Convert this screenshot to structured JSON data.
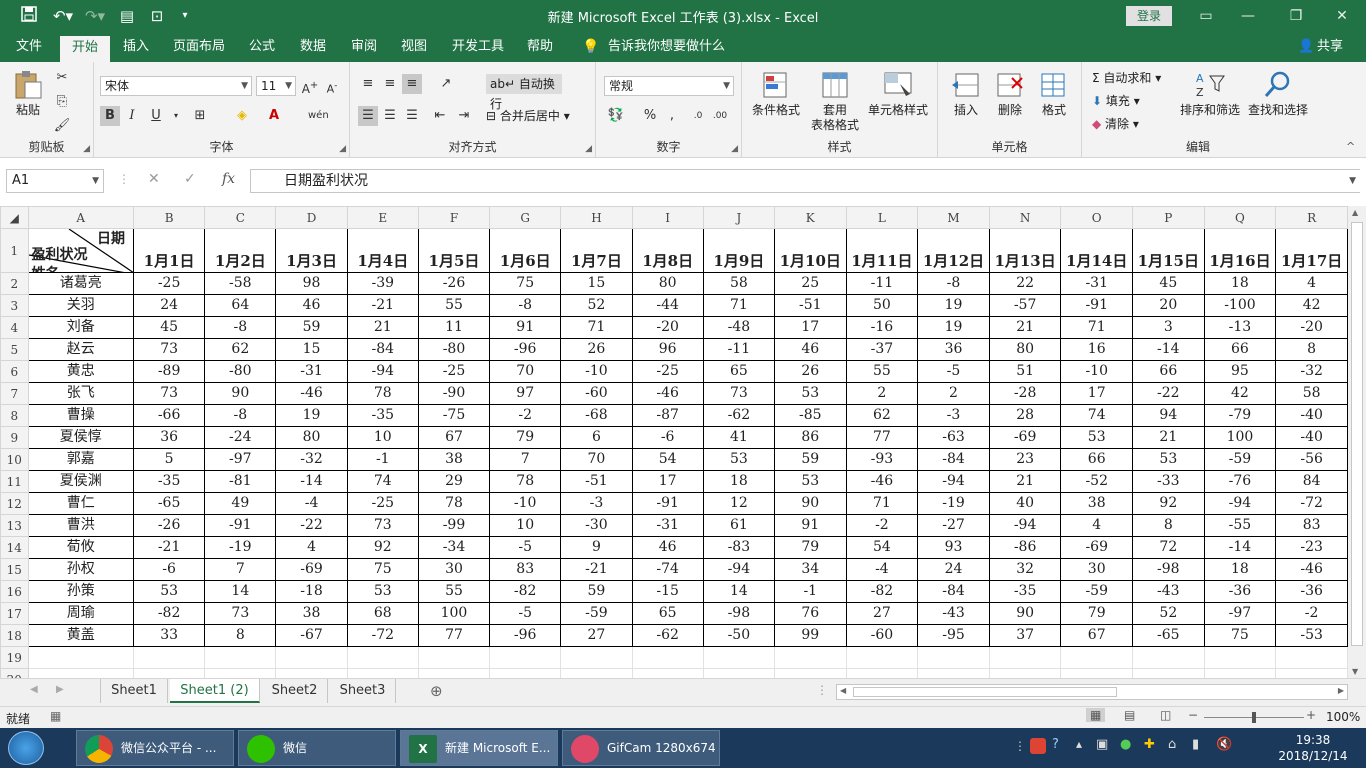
{
  "titlebar": {
    "title": "新建 Microsoft Excel 工作表 (3).xlsx  -  Excel",
    "login": "登录",
    "save_icon": "save-icon",
    "undo_icon": "undo-icon"
  },
  "tabs": [
    "文件",
    "开始",
    "插入",
    "页面布局",
    "公式",
    "数据",
    "审阅",
    "视图",
    "开发工具",
    "帮助"
  ],
  "tell_me": "告诉我你想要做什么",
  "share": "共享",
  "ribbon": {
    "clipboard": {
      "paste": "粘贴",
      "label": "剪贴板"
    },
    "font": {
      "name": "宋体",
      "size": "11",
      "label": "字体"
    },
    "align": {
      "wrap": "自动换行",
      "merge": "合并后居中",
      "label": "对齐方式"
    },
    "number": {
      "format": "常规",
      "label": "数字"
    },
    "styles": {
      "cond": "条件格式",
      "table1": "套用",
      "table2": "表格格式",
      "cell": "单元格样式",
      "label": "样式"
    },
    "cells": {
      "insert": "插入",
      "delete": "删除",
      "format": "格式",
      "label": "单元格"
    },
    "edit": {
      "autosum": "自动求和",
      "fill": "填充",
      "clear": "清除",
      "sort": "排序和筛选",
      "find": "查找和选择",
      "label": "编辑"
    }
  },
  "formula": {
    "cell": "A1",
    "content": "日期盈利状况",
    "fx": "fx"
  },
  "sheet": {
    "columns": [
      "A",
      "B",
      "C",
      "D",
      "E",
      "F",
      "G",
      "H",
      "I",
      "J",
      "K",
      "L",
      "M",
      "N",
      "O",
      "P",
      "Q",
      "R"
    ],
    "diag": {
      "top": "日期",
      "mid": "盈利状况",
      "bottom": "姓名"
    },
    "dates": [
      "1月1日",
      "1月2日",
      "1月3日",
      "1月4日",
      "1月5日",
      "1月6日",
      "1月7日",
      "1月8日",
      "1月9日",
      "1月10日",
      "1月11日",
      "1月12日",
      "1月13日",
      "1月14日",
      "1月15日",
      "1月16日",
      "1月17日"
    ],
    "rows": [
      {
        "name": "诸葛亮",
        "v": [
          "-25",
          "-58",
          "98",
          "-39",
          "-26",
          "75",
          "15",
          "80",
          "58",
          "25",
          "-11",
          "-8",
          "22",
          "-31",
          "45",
          "18",
          "4"
        ]
      },
      {
        "name": "关羽",
        "v": [
          "24",
          "64",
          "46",
          "-21",
          "55",
          "-8",
          "52",
          "-44",
          "71",
          "-51",
          "50",
          "19",
          "-57",
          "-91",
          "20",
          "-100",
          "42"
        ]
      },
      {
        "name": "刘备",
        "v": [
          "45",
          "-8",
          "59",
          "21",
          "11",
          "91",
          "71",
          "-20",
          "-48",
          "17",
          "-16",
          "19",
          "21",
          "71",
          "3",
          "-13",
          "-20"
        ]
      },
      {
        "name": "赵云",
        "v": [
          "73",
          "62",
          "15",
          "-84",
          "-80",
          "-96",
          "26",
          "96",
          "-11",
          "46",
          "-37",
          "36",
          "80",
          "16",
          "-14",
          "66",
          "8"
        ]
      },
      {
        "name": "黄忠",
        "v": [
          "-89",
          "-80",
          "-31",
          "-94",
          "-25",
          "70",
          "-10",
          "-25",
          "65",
          "26",
          "55",
          "-5",
          "51",
          "-10",
          "66",
          "95",
          "-32"
        ]
      },
      {
        "name": "张飞",
        "v": [
          "73",
          "90",
          "-46",
          "78",
          "-90",
          "97",
          "-60",
          "-46",
          "73",
          "53",
          "2",
          "2",
          "-28",
          "17",
          "-22",
          "42",
          "58"
        ]
      },
      {
        "name": "曹操",
        "v": [
          "-66",
          "-8",
          "19",
          "-35",
          "-75",
          "-2",
          "-68",
          "-87",
          "-62",
          "-85",
          "62",
          "-3",
          "28",
          "74",
          "94",
          "-79",
          "-40"
        ]
      },
      {
        "name": "夏侯惇",
        "v": [
          "36",
          "-24",
          "80",
          "10",
          "67",
          "79",
          "6",
          "-6",
          "41",
          "86",
          "77",
          "-63",
          "-69",
          "53",
          "21",
          "100",
          "-40"
        ]
      },
      {
        "name": "郭嘉",
        "v": [
          "5",
          "-97",
          "-32",
          "-1",
          "38",
          "7",
          "70",
          "54",
          "53",
          "59",
          "-93",
          "-84",
          "23",
          "66",
          "53",
          "-59",
          "-56"
        ]
      },
      {
        "name": "夏侯渊",
        "v": [
          "-35",
          "-81",
          "-14",
          "74",
          "29",
          "78",
          "-51",
          "17",
          "18",
          "53",
          "-46",
          "-94",
          "21",
          "-52",
          "-33",
          "-76",
          "84"
        ]
      },
      {
        "name": "曹仁",
        "v": [
          "-65",
          "49",
          "-4",
          "-25",
          "78",
          "-10",
          "-3",
          "-91",
          "12",
          "90",
          "71",
          "-19",
          "40",
          "38",
          "92",
          "-94",
          "-72"
        ]
      },
      {
        "name": "曹洪",
        "v": [
          "-26",
          "-91",
          "-22",
          "73",
          "-99",
          "10",
          "-30",
          "-31",
          "61",
          "91",
          "-2",
          "-27",
          "-94",
          "4",
          "8",
          "-55",
          "83"
        ]
      },
      {
        "name": "荀攸",
        "v": [
          "-21",
          "-19",
          "4",
          "92",
          "-34",
          "-5",
          "9",
          "46",
          "-83",
          "79",
          "54",
          "93",
          "-86",
          "-69",
          "72",
          "-14",
          "-23"
        ]
      },
      {
        "name": "孙权",
        "v": [
          "-6",
          "7",
          "-69",
          "75",
          "30",
          "83",
          "-21",
          "-74",
          "-94",
          "34",
          "-4",
          "24",
          "32",
          "30",
          "-98",
          "18",
          "-46"
        ]
      },
      {
        "name": "孙策",
        "v": [
          "53",
          "14",
          "-18",
          "53",
          "55",
          "-82",
          "59",
          "-15",
          "14",
          "-1",
          "-82",
          "-84",
          "-35",
          "-59",
          "-43",
          "-36",
          "-36"
        ]
      },
      {
        "name": "周瑜",
        "v": [
          "-82",
          "73",
          "38",
          "68",
          "100",
          "-5",
          "-59",
          "65",
          "-98",
          "76",
          "27",
          "-43",
          "90",
          "79",
          "52",
          "-97",
          "-2"
        ]
      },
      {
        "name": "黄盖",
        "v": [
          "33",
          "8",
          "-67",
          "-72",
          "77",
          "-96",
          "27",
          "-62",
          "-50",
          "99",
          "-60",
          "-95",
          "37",
          "67",
          "-65",
          "75",
          "-53"
        ]
      }
    ]
  },
  "sheets": [
    "Sheet1",
    "Sheet1 (2)",
    "Sheet2",
    "Sheet3"
  ],
  "status": {
    "ready": "就绪",
    "zoom": "100%"
  },
  "taskbar": {
    "items": [
      "微信公众平台 - ...",
      "微信",
      "新建 Microsoft E...",
      "GifCam 1280x674"
    ],
    "time": "19:38",
    "date": "2018/12/14"
  },
  "colors": {
    "excel_green": "#217346",
    "taskbar": "#1b3a5b"
  }
}
